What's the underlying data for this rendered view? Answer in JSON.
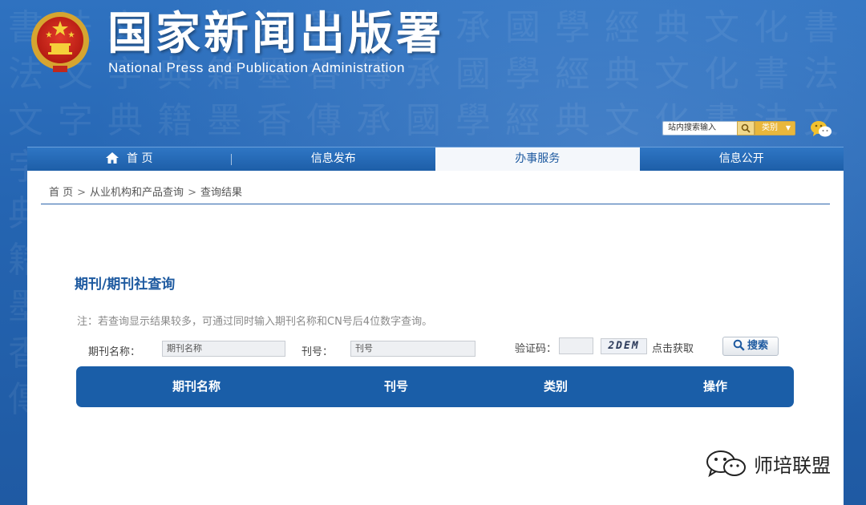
{
  "header": {
    "title": "国家新闻出版署",
    "subtitle": "National Press and Publication Administration",
    "site_search": {
      "placeholder": "站内搜索输入",
      "category_label": "类别"
    }
  },
  "nav": {
    "items": [
      {
        "label": "首 页",
        "icon": "home-icon",
        "active": false
      },
      {
        "label": "信息发布",
        "active": false
      },
      {
        "label": "办事服务",
        "active": true
      },
      {
        "label": "信息公开",
        "active": false
      }
    ]
  },
  "breadcrumb": {
    "items": [
      "首 页",
      "从业机构和产品查询",
      "查询结果"
    ],
    "separator": ">"
  },
  "query": {
    "title": "期刊/期刊社查询",
    "note": "注：若查询显示结果较多，可通过同时输入期刊名称和CN号后4位数字查询。",
    "name_label": "期刊名称：",
    "name_placeholder": "期刊名称",
    "issue_label": "刊号：",
    "issue_placeholder": "刊号",
    "captcha_label": "验证码：",
    "captcha_value": "",
    "captcha_text": "2DEM",
    "captcha_refresh": "点击获取",
    "search_label": "搜索"
  },
  "table": {
    "columns": [
      "期刊名称",
      "刊号",
      "类别",
      "操作"
    ]
  },
  "watermark": {
    "text": "师培联盟"
  },
  "colors": {
    "primary": "#1a5ea8",
    "accent": "#e9b73c",
    "background": "#2a6bb8"
  }
}
